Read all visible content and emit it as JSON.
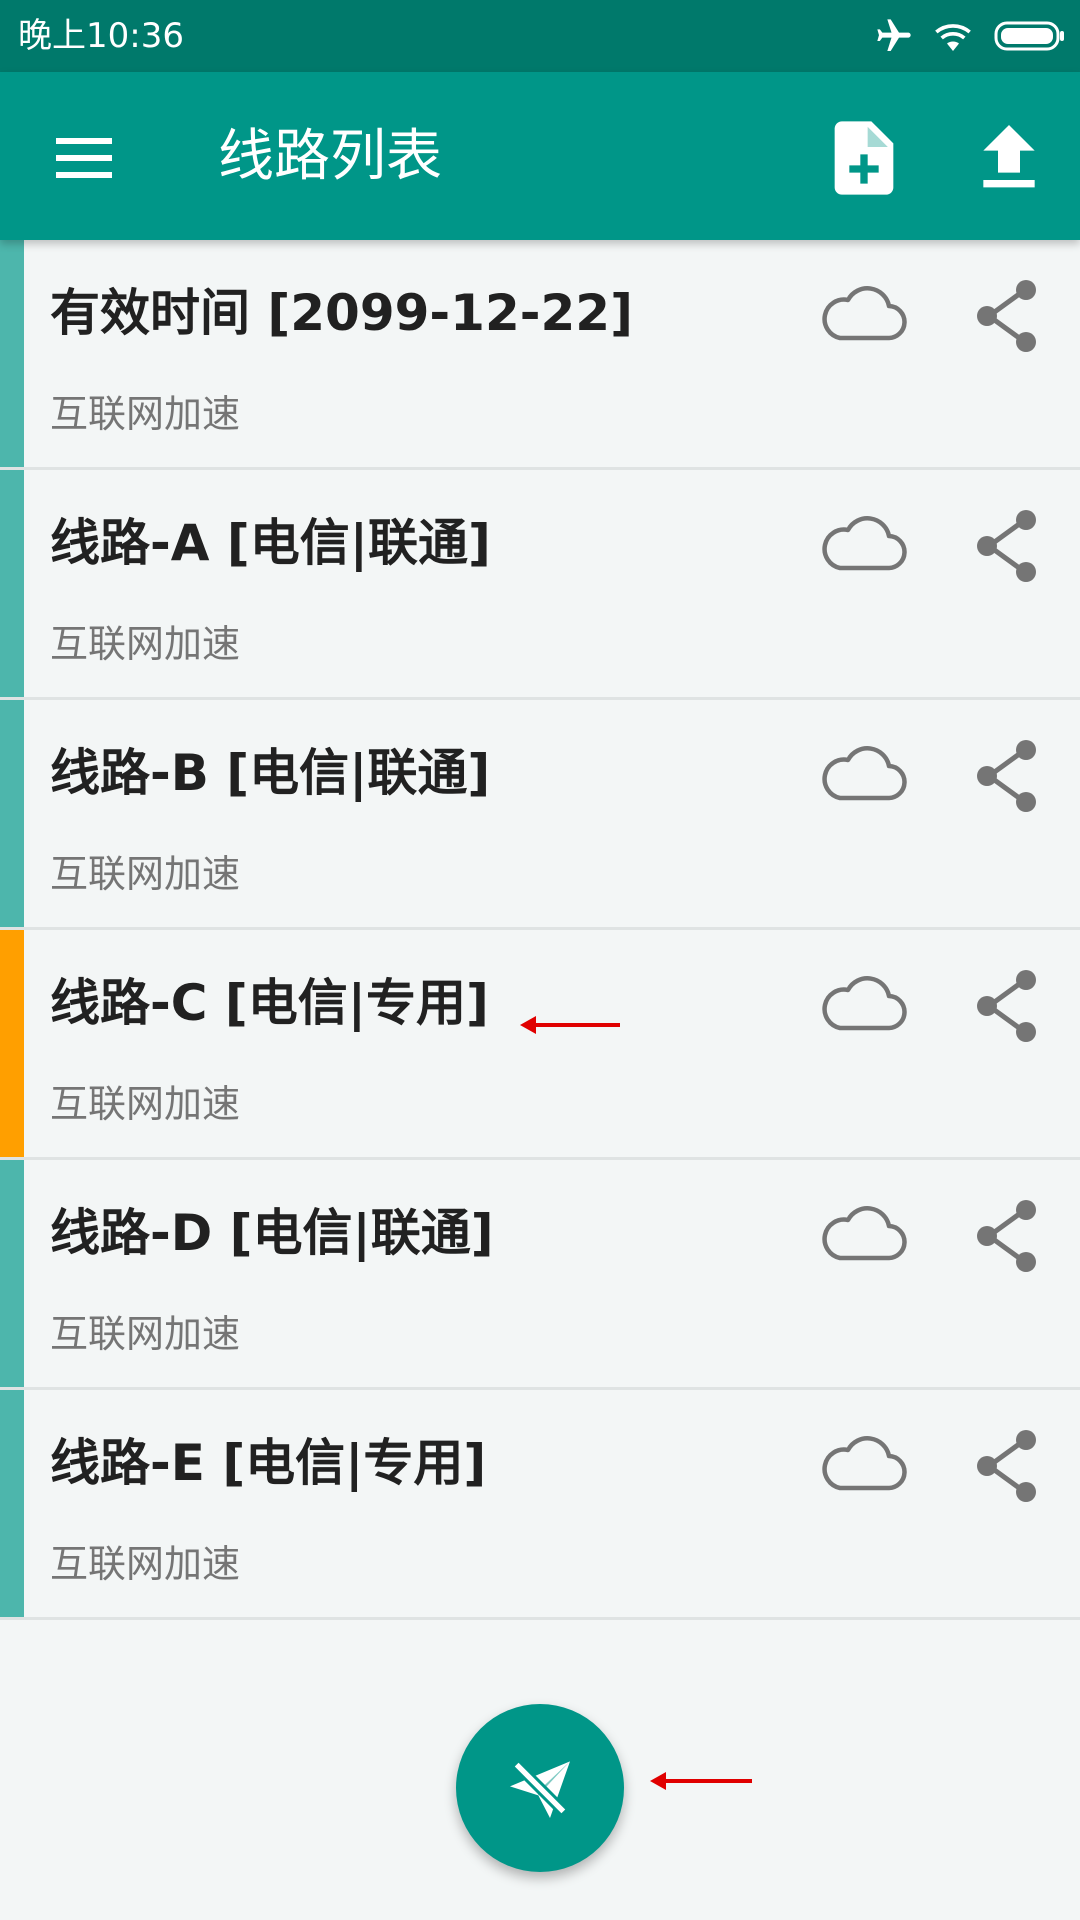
{
  "status_bar": {
    "time": "晚上10:36",
    "icons": [
      "airplane-mode-icon",
      "wifi-icon",
      "battery-icon"
    ]
  },
  "app_bar": {
    "title": "线路列表",
    "icons": [
      "menu-icon",
      "add-file-icon",
      "upload-icon"
    ]
  },
  "servers": [
    {
      "title": "有效时间 [2099-12-22]",
      "subtitle": "互联网加速",
      "active": false
    },
    {
      "title": "线路-A [电信|联通]",
      "subtitle": "互联网加速",
      "active": false
    },
    {
      "title": "线路-B [电信|联通]",
      "subtitle": "互联网加速",
      "active": false
    },
    {
      "title": "线路-C [电信|专用]",
      "subtitle": "互联网加速",
      "active": true
    },
    {
      "title": "线路-D [电信|联通]",
      "subtitle": "互联网加速",
      "active": false
    },
    {
      "title": "线路-E [电信|专用]",
      "subtitle": "互联网加速",
      "active": false
    }
  ],
  "item_icons": [
    "cloud-icon",
    "share-icon"
  ],
  "fab": {
    "icon": "paper-plane-off-icon"
  },
  "colors": {
    "status_bar": "#00796b",
    "app_bar": "#009688",
    "indicator": "#4db6ac",
    "active_indicator": "#ff9f00",
    "annotation_arrow": "#e00000"
  }
}
